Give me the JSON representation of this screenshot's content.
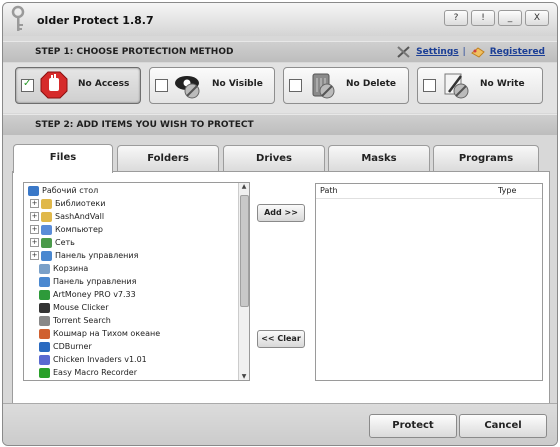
{
  "window": {
    "title": "older Protect 1.8.7",
    "controls": [
      "?",
      "!",
      "_",
      "X"
    ]
  },
  "step1": {
    "label": "STEP 1: CHOOSE PROTECTION METHOD",
    "settings": "Settings",
    "separator": "|",
    "registered": "Registered"
  },
  "methods": [
    {
      "label": "No Access",
      "checked": true,
      "icon": "no-access-icon"
    },
    {
      "label": "No Visible",
      "checked": false,
      "icon": "no-visible-icon"
    },
    {
      "label": "No Delete",
      "checked": false,
      "icon": "no-delete-icon"
    },
    {
      "label": "No Write",
      "checked": false,
      "icon": "no-write-icon"
    }
  ],
  "step2": {
    "label": "STEP 2: ADD ITEMS YOU WISH TO PROTECT"
  },
  "tabs": [
    "Files",
    "Folders",
    "Drives",
    "Masks",
    "Programs"
  ],
  "active_tab": "Files",
  "tree": [
    {
      "label": "Рабочий стол",
      "expand": "",
      "icon": "desktop-icon",
      "color": "#3a78c8"
    },
    {
      "label": "Библиотеки",
      "expand": "+",
      "icon": "library-icon",
      "color": "#e0b84a"
    },
    {
      "label": "SashAndVall",
      "expand": "+",
      "icon": "user-folder-icon",
      "color": "#e0b84a"
    },
    {
      "label": "Компьютер",
      "expand": "+",
      "icon": "computer-icon",
      "color": "#5a8cd8"
    },
    {
      "label": "Сеть",
      "expand": "+",
      "icon": "network-icon",
      "color": "#4a9a4a"
    },
    {
      "label": "Панель управления",
      "expand": "+",
      "icon": "control-panel-icon",
      "color": "#4a88d0"
    },
    {
      "label": "Корзина",
      "expand": "",
      "icon": "recycle-bin-icon",
      "color": "#7aa0c8"
    },
    {
      "label": "Панель управления",
      "expand": "",
      "icon": "control-panel-icon",
      "color": "#4a88d0"
    },
    {
      "label": "ArtMoney PRO v7.33",
      "expand": "",
      "icon": "artmoney-icon",
      "color": "#2e9a3a"
    },
    {
      "label": "Mouse Clicker",
      "expand": "",
      "icon": "mouse-icon",
      "color": "#333333"
    },
    {
      "label": "Torrent Search",
      "expand": "",
      "icon": "torrent-icon",
      "color": "#888888"
    },
    {
      "label": "Кошмар на Тихом океане",
      "expand": "",
      "icon": "game-icon",
      "color": "#d06030"
    },
    {
      "label": "CDBurner",
      "expand": "",
      "icon": "cdburner-icon",
      "color": "#2a6ac0"
    },
    {
      "label": "Chicken Invaders v1.01",
      "expand": "",
      "icon": "chicken-icon",
      "color": "#5a6ad0"
    },
    {
      "label": "Easy Macro Recorder",
      "expand": "",
      "icon": "macro-icon",
      "color": "#2aa02a"
    }
  ],
  "buttons": {
    "add": "Add >>",
    "clear": "<< Clear"
  },
  "list": {
    "col_path": "Path",
    "col_type": "Type"
  },
  "footer": {
    "protect": "Protect",
    "cancel": "Cancel"
  }
}
